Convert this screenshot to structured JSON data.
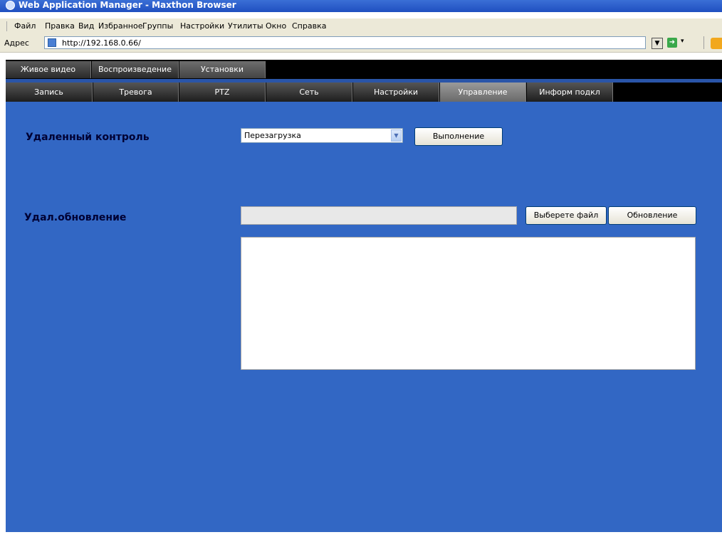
{
  "window": {
    "title": "Web Application Manager - Maxthon Browser"
  },
  "menubar": {
    "items": [
      "Файл",
      "Правка",
      "Вид",
      "Избранное",
      "Группы",
      "Настройки",
      "Утилиты",
      "Окно",
      "Справка"
    ]
  },
  "address": {
    "label": "Адрес",
    "url": "http://192.168.0.66/"
  },
  "tabs_main": [
    {
      "label": "Живое видео",
      "active": false
    },
    {
      "label": "Воспроизведение",
      "active": false
    },
    {
      "label": "Установки",
      "active": true
    }
  ],
  "tabs_sub": [
    {
      "label": "Запись",
      "active": false
    },
    {
      "label": "Тревога",
      "active": false
    },
    {
      "label": "PTZ",
      "active": false
    },
    {
      "label": "Сеть",
      "active": false
    },
    {
      "label": "Настройки",
      "active": false
    },
    {
      "label": "Управление",
      "active": true
    },
    {
      "label": "Информ подкл",
      "active": false
    }
  ],
  "remote_control": {
    "label": "Удаленный контроль",
    "selected": "Перезагрузка",
    "execute_label": "Выполнение"
  },
  "remote_update": {
    "label": "Удал.обновление",
    "file_value": "",
    "choose_file_label": "Выберете файл",
    "update_label": "Обновление",
    "log_text": ""
  },
  "colors": {
    "app_background": "#3267c4",
    "tab_bar": "#000000",
    "active_sub_tab": "#808080"
  }
}
